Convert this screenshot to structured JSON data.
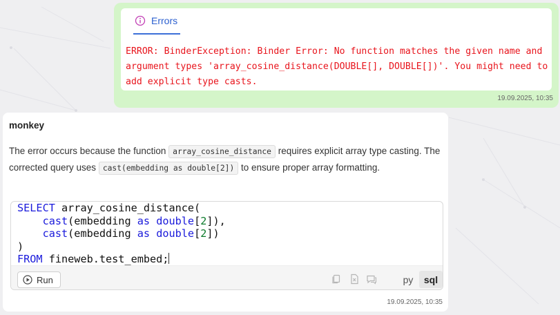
{
  "user_message": {
    "tab_label": "Errors",
    "error_text": "ERROR: BinderException: Binder Error: No function matches the given name and argument types 'array_cosine_distance(DOUBLE[], DOUBLE[])'. You might need to add explicit type casts.",
    "timestamp": "19.09.2025, 10:35"
  },
  "assistant_message": {
    "author": "monkey",
    "text_part1": "The error occurs because the function",
    "inline_code1": "array_cosine_distance",
    "text_part2": "requires explicit array type casting. The corrected query uses",
    "inline_code2": "cast(embedding as double[2])",
    "text_part3": "to ensure proper array formatting.",
    "code": {
      "line1_kw": "SELECT",
      "line1_rest": " array_cosine_distance(",
      "line2_fn": "cast",
      "line2_a": "(embedding ",
      "line2_as": "as",
      "line2_type": "double",
      "line2_b": "[",
      "line2_num": "2",
      "line2_c": "]),",
      "line3_fn": "cast",
      "line3_a": "(embedding ",
      "line3_as": "as",
      "line3_type": "double",
      "line3_b": "[",
      "line3_num": "2",
      "line3_c": "])",
      "line4": ")",
      "line5_kw": "FROM",
      "line5_rest": " fineweb.test_embed;"
    },
    "run_label": "Run",
    "lang_tabs": [
      "py",
      "sql"
    ],
    "active_lang": "sql",
    "timestamp": "19.09.2025, 10:35"
  },
  "colors": {
    "user_bubble": "#d4f5c9",
    "error_text": "#e8141c",
    "tab_accent": "#2b5fcf",
    "keyword": "#1a1adb"
  },
  "icons": [
    "info-icon",
    "play-icon",
    "copy-icon",
    "export-icon",
    "comment-icon"
  ]
}
